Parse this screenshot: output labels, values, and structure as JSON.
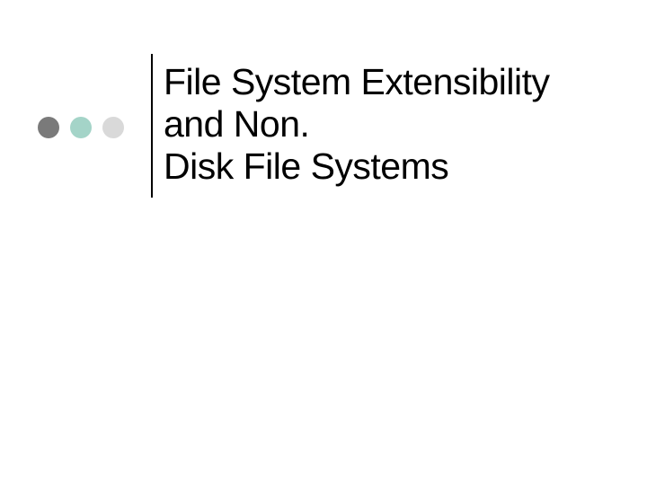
{
  "slide": {
    "title": "File System Extensibility and Non.\nDisk File Systems"
  },
  "decorations": {
    "dot_colors": [
      "#7a7a7a",
      "#a4d4c8",
      "#d9d9d9"
    ]
  }
}
